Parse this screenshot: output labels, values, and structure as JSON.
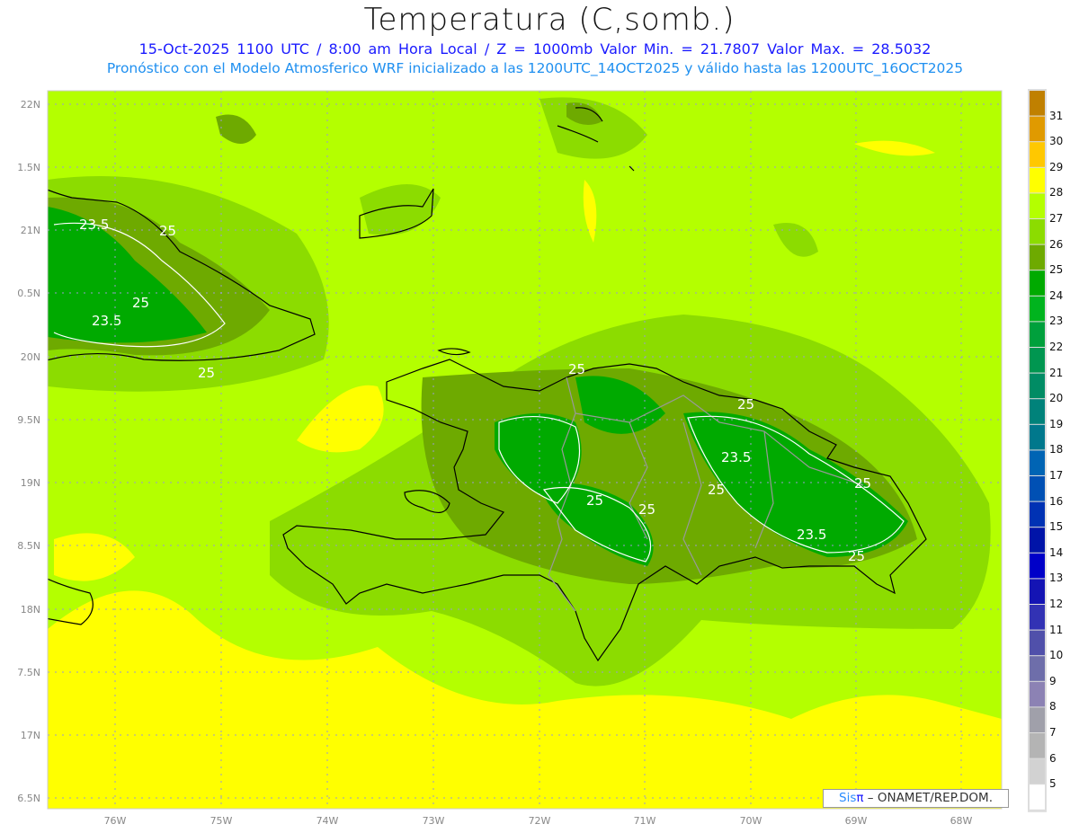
{
  "header": {
    "title": "Temperatura (C,somb.)",
    "subtitle_line1": "15-Oct-2025  1100 UTC / 8:00 am Hora Local / Z = 1000mb   Valor Min. = 21.7807  Valor Max. = 28.5032",
    "subtitle_line2": "Pronóstico con el Modelo Atmosferico WRF inicializado a las 1200UTC_14OCT2025 y válido hasta las  1200UTC_16OCT2025"
  },
  "axes": {
    "lat_labels": [
      "22N",
      "1.5N",
      "21N",
      "0.5N",
      "20N",
      "9.5N",
      "19N",
      "8.5N",
      "18N",
      "7.5N",
      "17N",
      "6.5N"
    ],
    "lon_labels": [
      "76W",
      "75W",
      "74W",
      "73W",
      "72W",
      "71W",
      "70W",
      "69W",
      "68W"
    ]
  },
  "colorbar": {
    "labels": [
      "31",
      "30",
      "29",
      "28",
      "27",
      "26",
      "25",
      "24",
      "23",
      "22",
      "21",
      "20",
      "19",
      "18",
      "17",
      "16",
      "15",
      "14",
      "13",
      "12",
      "11",
      "10",
      "9",
      "8",
      "7",
      "6",
      "5"
    ],
    "colors": [
      "#c08000",
      "#e09a00",
      "#ffc800",
      "#ffff00",
      "#b4ff00",
      "#8cdc00",
      "#6eaa00",
      "#00aa00",
      "#00b41e",
      "#00a03c",
      "#009650",
      "#008c64",
      "#00827a",
      "#00788c",
      "#0064b4",
      "#0050b4",
      "#0032b4",
      "#0014a8",
      "#0000c8",
      "#1414b4",
      "#3232b4",
      "#5050aa",
      "#6e6eaa",
      "#8c82b4",
      "#a0a0aa",
      "#b4b4b4",
      "#d2d2d2",
      "#ffffff"
    ]
  },
  "contour_labels": [
    "23.5",
    "25",
    "25",
    "23.5",
    "25",
    "25",
    "25",
    "25",
    "25",
    "23.5",
    "25",
    "25",
    "23.5",
    "25"
  ],
  "credit": {
    "sis": "Sis",
    "pi": "π",
    "rest": " – ONAMET/REP.DOM."
  }
}
